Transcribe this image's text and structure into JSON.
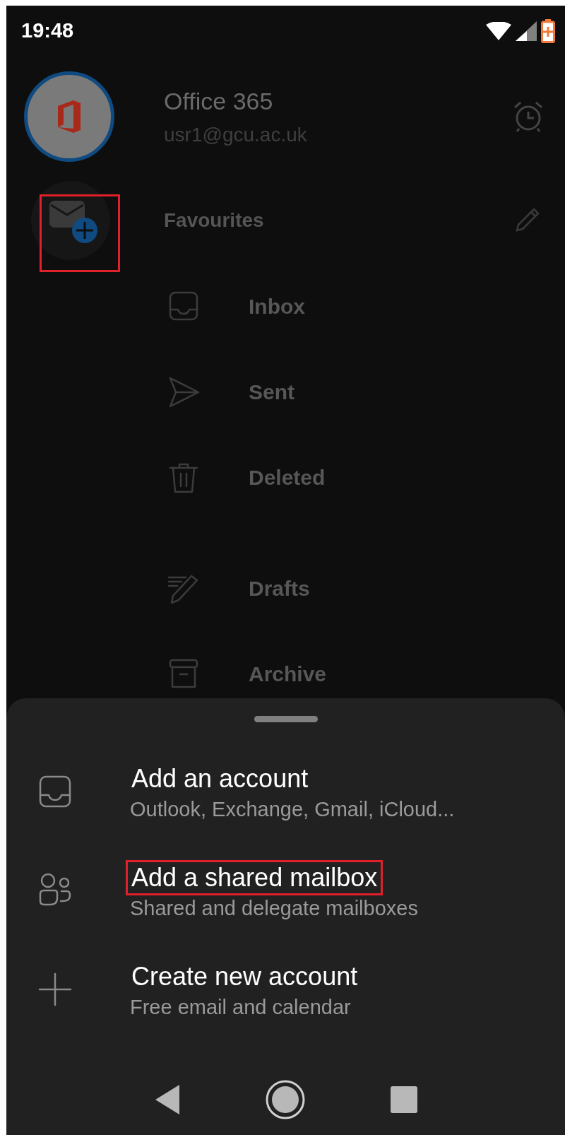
{
  "status_bar": {
    "time": "19:48"
  },
  "account": {
    "name": "Office 365",
    "email": "usr1@gcu.ac.uk"
  },
  "add_mailbox_button": {
    "highlighted": true
  },
  "favourites": {
    "label": "Favourites"
  },
  "folders": [
    {
      "label": "Inbox",
      "kind": "inbox"
    },
    {
      "label": "Sent",
      "kind": "sent"
    },
    {
      "label": "Deleted",
      "kind": "deleted"
    },
    {
      "label": "Drafts",
      "kind": "drafts"
    },
    {
      "label": "Archive",
      "kind": "archive"
    }
  ],
  "sheet": {
    "items": [
      {
        "title": "Add an account",
        "subtitle": "Outlook, Exchange, Gmail, iCloud...",
        "kind": "inbox",
        "highlighted": false
      },
      {
        "title": "Add a shared mailbox",
        "subtitle": "Shared and delegate mailboxes",
        "kind": "people",
        "highlighted": true
      },
      {
        "title": "Create new account",
        "subtitle": "Free email and calendar",
        "kind": "plus",
        "highlighted": false
      }
    ]
  }
}
